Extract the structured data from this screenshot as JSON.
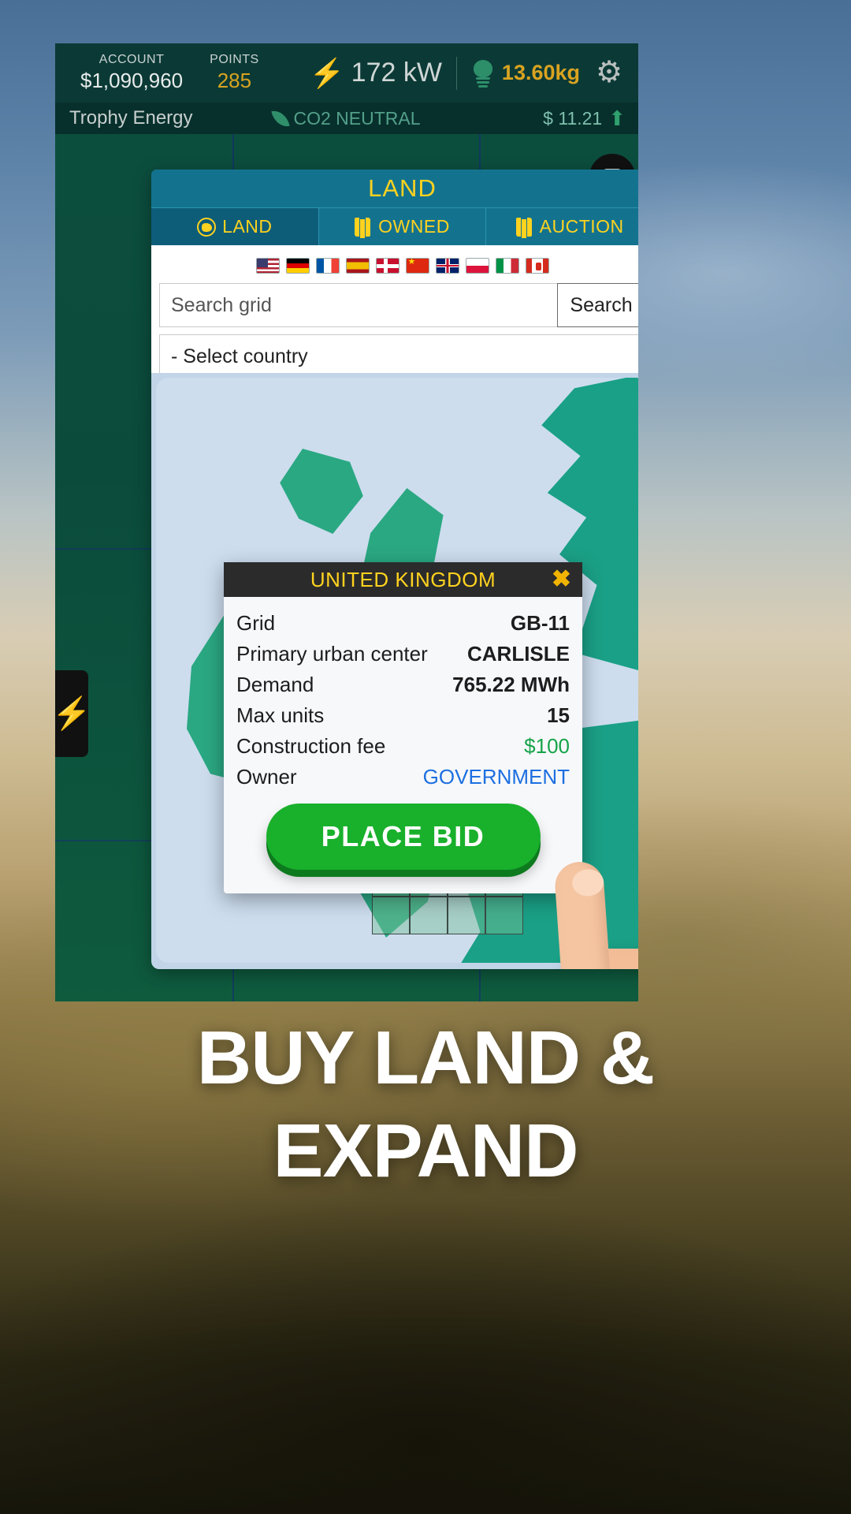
{
  "hud": {
    "account_label": "ACCOUNT",
    "account_value": "$1,090,960",
    "points_label": "POINTS",
    "points_value": "285",
    "power": "172 kW",
    "co2": "13.60kg",
    "bolt_icon": "lightning-bolt-icon",
    "tree_icon": "tree-icon",
    "gear_icon": "gear-icon"
  },
  "subhud": {
    "company": "Trophy Energy",
    "co2_status": "CO2 NEUTRAL",
    "price": "$ 11.21",
    "trend": "up"
  },
  "panel": {
    "title": "LAND",
    "tabs": [
      {
        "label": "LAND",
        "icon": "globe-icon",
        "active": true
      },
      {
        "label": "OWNED",
        "icon": "map-icon",
        "active": false
      },
      {
        "label": "AUCTION",
        "icon": "map-icon",
        "active": false
      }
    ],
    "flags": [
      {
        "code": "us",
        "name": "United States"
      },
      {
        "code": "de",
        "name": "Germany"
      },
      {
        "code": "fr",
        "name": "France"
      },
      {
        "code": "es",
        "name": "Spain"
      },
      {
        "code": "dk",
        "name": "Denmark"
      },
      {
        "code": "cn",
        "name": "China"
      },
      {
        "code": "gb",
        "name": "United Kingdom"
      },
      {
        "code": "pl",
        "name": "Poland"
      },
      {
        "code": "it",
        "name": "Italy"
      },
      {
        "code": "ca",
        "name": "Canada"
      }
    ],
    "search_placeholder": "Search grid",
    "search_value": "",
    "search_button": "Search",
    "country_select": "- Select country"
  },
  "card": {
    "title": "UNITED KINGDOM",
    "close_icon": "close-icon",
    "rows": [
      {
        "key": "Grid",
        "value": "GB-11",
        "style": "bold"
      },
      {
        "key": "Primary urban center",
        "value": "CARLISLE",
        "style": "bold"
      },
      {
        "key": "Demand",
        "value": "765.22 MWh",
        "style": "bold"
      },
      {
        "key": "Max units",
        "value": "15",
        "style": "bold"
      },
      {
        "key": "Construction fee",
        "value": "$100",
        "style": "money"
      },
      {
        "key": "Owner",
        "value": "GOVERNMENT",
        "style": "owner"
      }
    ],
    "bid_button": "PLACE BID"
  },
  "sidebar": {
    "buttons": [
      {
        "icon": "rounded-square-icon",
        "active": true
      },
      {
        "icon": "transmission-tower-icon",
        "active": false
      },
      {
        "icon": "lightning-bolt-icon",
        "active": false
      },
      {
        "icon": "battery-icon",
        "active": false
      }
    ]
  },
  "left_tab": {
    "icon": "lightning-bolt-icon"
  },
  "tagline": {
    "line1": "BUY LAND &",
    "line2": "EXPAND"
  },
  "colors": {
    "accent_yellow": "#ffd21f",
    "panel_blue": "#13738f",
    "hud_green": "#0b3a36",
    "bid_green": "#19b02c",
    "money_green": "#16a34a",
    "owner_blue": "#1d6fe0",
    "selected_cell": "#c7d933"
  }
}
